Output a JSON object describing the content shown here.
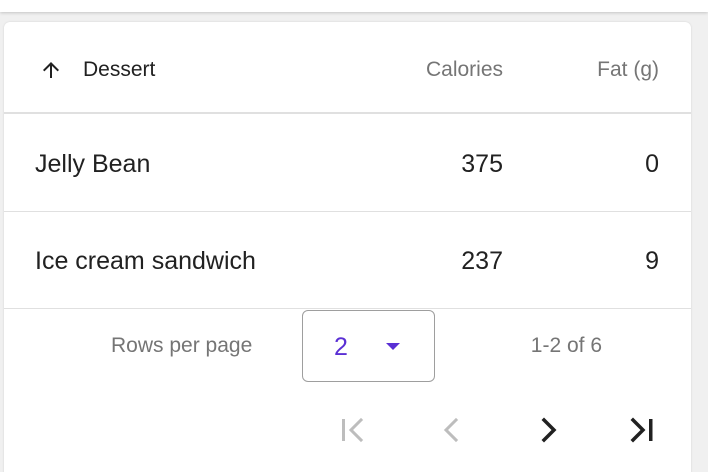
{
  "table": {
    "columns": {
      "dessert": "Dessert",
      "calories": "Calories",
      "fat": "Fat (g)"
    },
    "sort_icon": "arrow-upward-icon",
    "rows": [
      {
        "name": "Jelly Bean",
        "calories": "375",
        "fat": "0"
      },
      {
        "name": "Ice cream sandwich",
        "calories": "237",
        "fat": "9"
      }
    ]
  },
  "pagination": {
    "rows_per_page_label": "Rows per page",
    "rows_per_page_value": "2",
    "range_label": "1-2 of 6",
    "buttons": {
      "first": {
        "icon": "first-page-icon",
        "enabled": false
      },
      "previous": {
        "icon": "chevron-left-icon",
        "enabled": false
      },
      "next": {
        "icon": "chevron-right-icon",
        "enabled": true
      },
      "last": {
        "icon": "last-page-icon",
        "enabled": true
      }
    }
  },
  "colors": {
    "accent": "#5a2fd4",
    "disabled_icon": "#bdbdbd",
    "enabled_icon": "#212121",
    "header_text": "#757575",
    "body_text": "#212121",
    "divider": "#e0e0e0"
  }
}
